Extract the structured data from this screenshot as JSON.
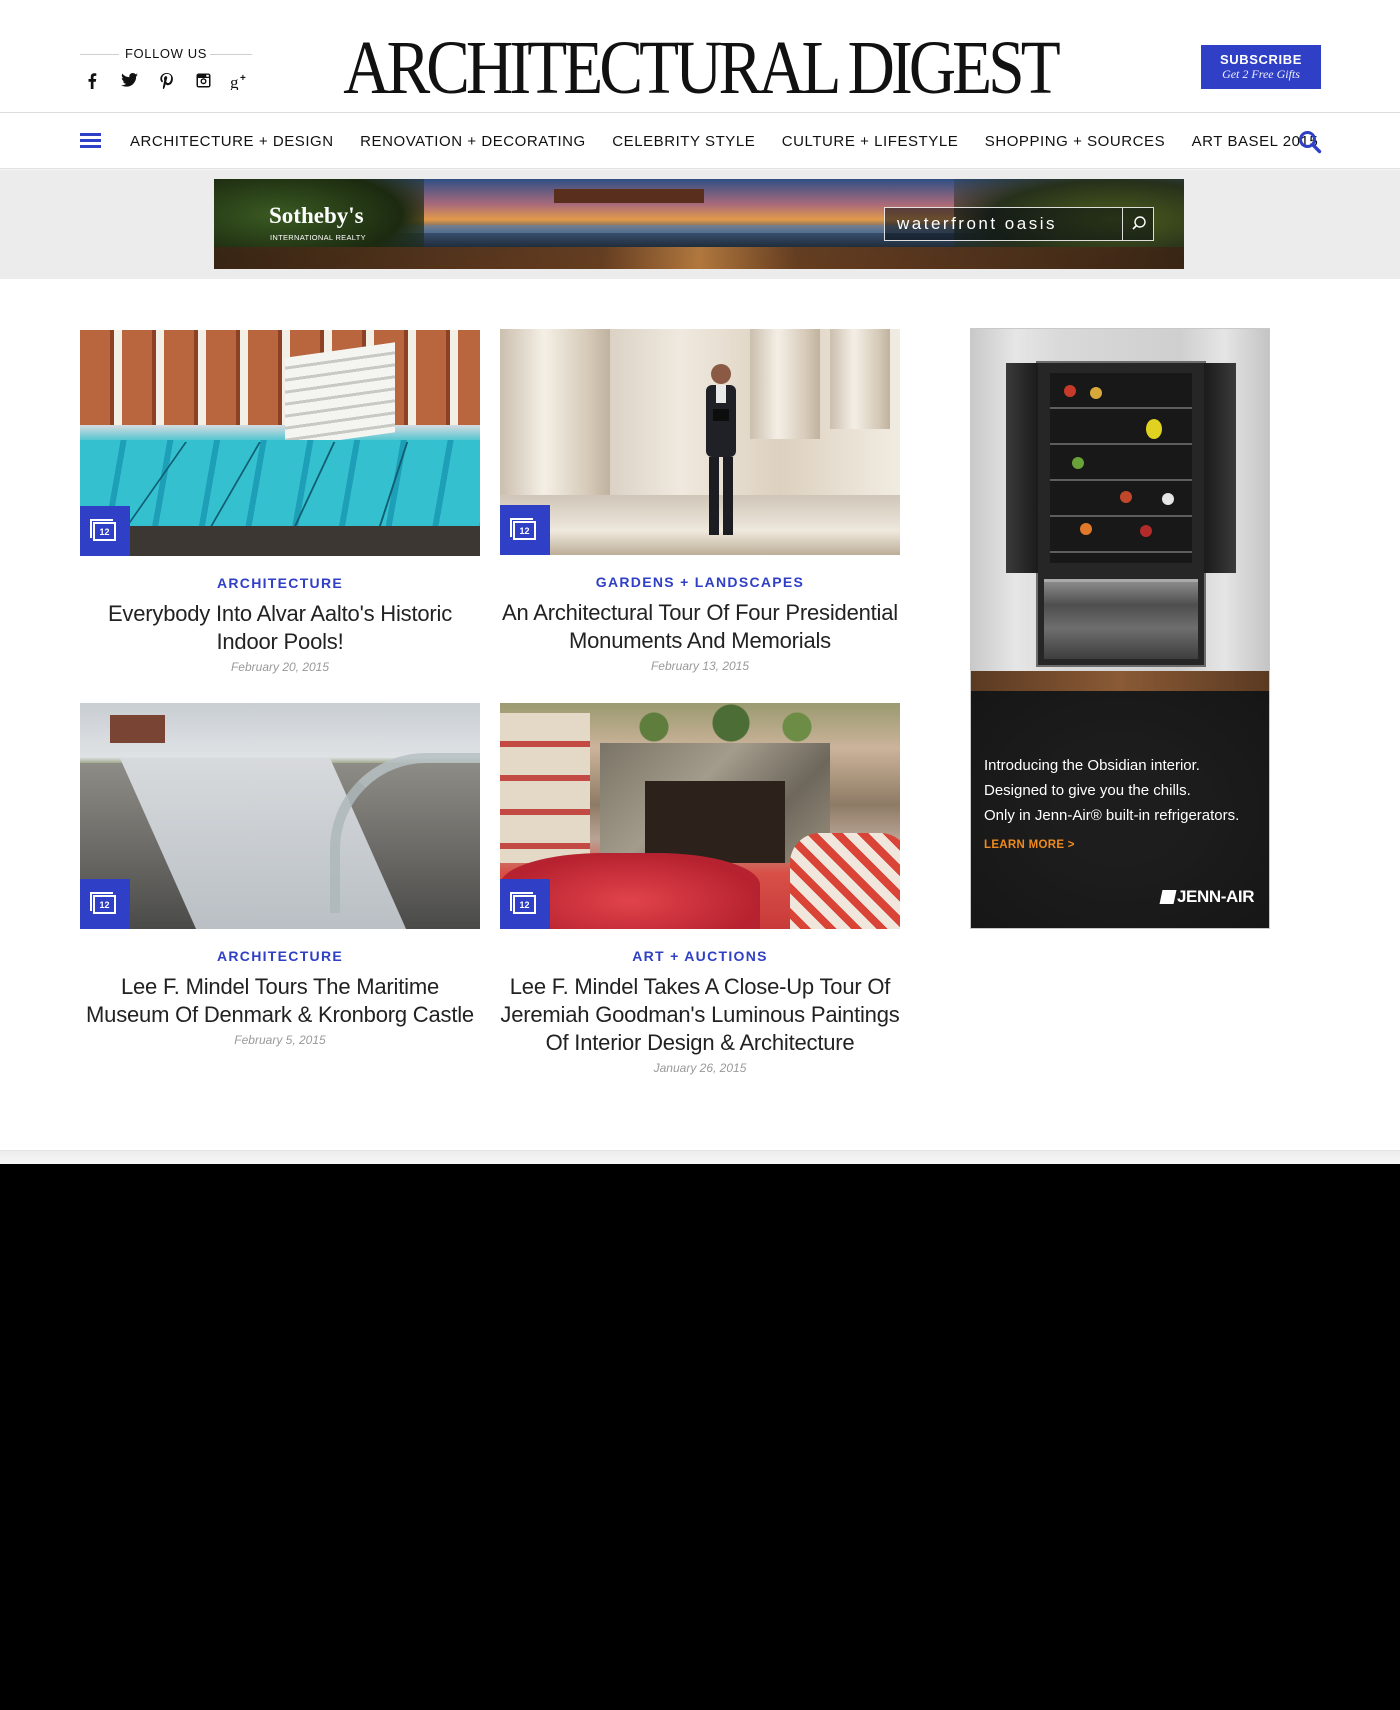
{
  "header": {
    "follow_label": "FOLLOW US",
    "social": [
      "facebook-icon",
      "twitter-icon",
      "pinterest-icon",
      "instagram-icon",
      "google-plus-icon"
    ],
    "logo": "ARCHITECTURAL DIGEST",
    "subscribe": {
      "label": "SUBSCRIBE",
      "sublabel": "Get 2 Free Gifts"
    }
  },
  "nav": {
    "items": [
      "ARCHITECTURE + DESIGN",
      "RENOVATION + DECORATING",
      "CELEBRITY STYLE",
      "CULTURE + LIFESTYLE",
      "SHOPPING + SOURCES",
      "ART BASEL 2015"
    ]
  },
  "banner_ad": {
    "brand": "Sotheby's",
    "brand_sub": "INTERNATIONAL REALTY",
    "search_value": "waterfront oasis"
  },
  "articles": [
    {
      "category": "ARCHITECTURE",
      "title": "Everybody Into Alvar Aalto's Historic Indoor Pools!",
      "date": "February 20, 2015",
      "photo_count": "12"
    },
    {
      "category": "GARDENS + LANDSCAPES",
      "title": "An Architectural Tour Of Four Presidential Monuments And Memorials",
      "date": "February 13, 2015",
      "photo_count": "12"
    },
    {
      "category": "ARCHITECTURE",
      "title": "Lee F. Mindel Tours The Maritime Museum Of Denmark & Kronborg Castle",
      "date": "February 5, 2015",
      "photo_count": "12"
    },
    {
      "category": "ART + AUCTIONS",
      "title": "Lee F. Mindel Takes A Close-Up Tour Of Jeremiah Goodman's Luminous Paintings Of Interior Design & Architecture",
      "date": "January 26, 2015",
      "photo_count": "12"
    }
  ],
  "side_ad": {
    "copy": [
      "Introducing the Obsidian interior.",
      "Designed to give you the chills.",
      "Only in Jenn-Air® built-in refrigerators."
    ],
    "cta": "LEARN MORE >",
    "brand": "JENN-AIR"
  },
  "colors": {
    "accent": "#3040c6",
    "cta_orange": "#f08a1d"
  }
}
